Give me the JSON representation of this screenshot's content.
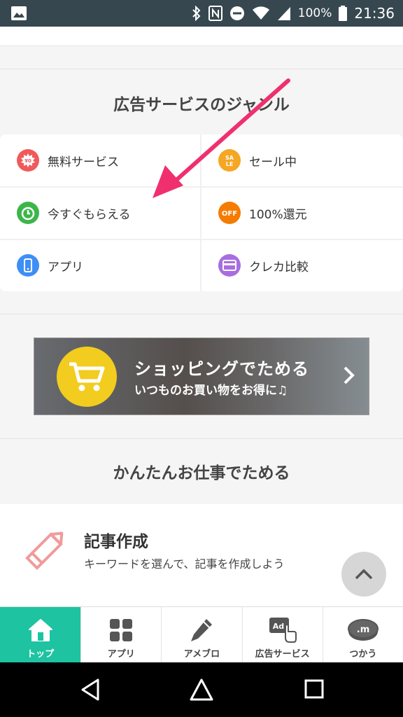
{
  "status_bar": {
    "battery_percent": "100%",
    "time": "21:36",
    "icons": [
      "gallery-icon",
      "bluetooth-icon",
      "nfc-icon",
      "dnd-icon",
      "wifi-icon",
      "signal-icon",
      "battery-icon"
    ]
  },
  "genres": {
    "title": "広告サービスのジャンル",
    "items": [
      {
        "label": "無料サービス",
        "icon": "free-badge-icon",
        "color": "#f05a5a"
      },
      {
        "label": "セール中",
        "icon": "sale-icon",
        "color": "#f5a623"
      },
      {
        "label": "今すぐもらえる",
        "icon": "clock-icon",
        "color": "#3cb64a"
      },
      {
        "label": "100%還元",
        "icon": "off-icon",
        "color": "#f57c00"
      },
      {
        "label": "アプリ",
        "icon": "smartphone-icon",
        "color": "#3f8ef5"
      },
      {
        "label": "クレカ比較",
        "icon": "credit-card-icon",
        "color": "#a86ee0"
      }
    ]
  },
  "banner": {
    "title": "ショッピングでためる",
    "subtitle": "いつものお買い物をお得に♫"
  },
  "jobs": {
    "title": "かんたんお仕事でためる",
    "item_title": "記事作成",
    "item_desc": "キーワードを選んで、記事を作成しよう"
  },
  "bottom_nav": [
    {
      "label": "トップ",
      "icon": "home-icon",
      "active": true
    },
    {
      "label": "アプリ",
      "icon": "apps-grid-icon",
      "active": false
    },
    {
      "label": "アメブロ",
      "icon": "pencil-icon",
      "active": false
    },
    {
      "label": "広告サービス",
      "icon": "ad-tap-icon",
      "active": false
    },
    {
      "label": "つかう",
      "icon": "coin-icon",
      "active": false
    }
  ],
  "colors": {
    "accent": "#1ec3a1",
    "status_bar": "#37474f",
    "annotation_arrow": "#f0306e",
    "banner_circle": "#f2cc1f"
  }
}
